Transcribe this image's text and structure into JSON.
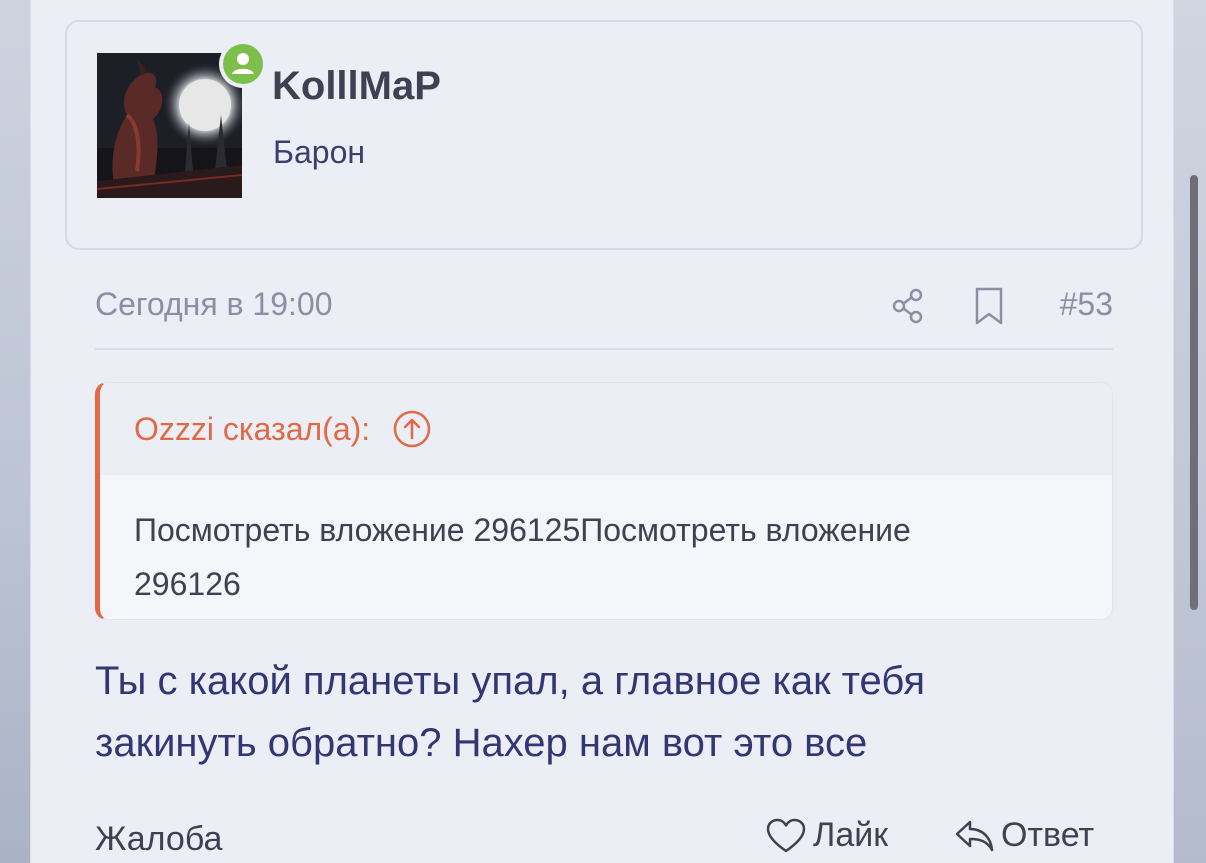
{
  "author": {
    "name": "KolllMaP",
    "rank": "Барон",
    "online": true
  },
  "post": {
    "date": "Сегодня в 19:00",
    "number": "#53",
    "message": "Ты с какой планеты упал, а главное как тебя закинуть обратно? Нахер нам вот это все"
  },
  "quote": {
    "author": "Ozzzi сказал(а):",
    "text": "Посмотреть вложение 296125Посмотреть вложение 296126"
  },
  "actions": {
    "report": "Жалоба",
    "like": "Лайк",
    "reply": "Ответ"
  },
  "icons": {
    "online": "user-online-icon",
    "share": "share-icon",
    "bookmark": "bookmark-icon",
    "quote_jump": "arrow-up-circle-icon",
    "like": "heart-icon",
    "reply": "reply-icon"
  },
  "colors": {
    "accent": "#e16946",
    "online": "#7cc04b",
    "text": "#3f4152",
    "message": "#323672",
    "muted": "#8c8fa3"
  }
}
